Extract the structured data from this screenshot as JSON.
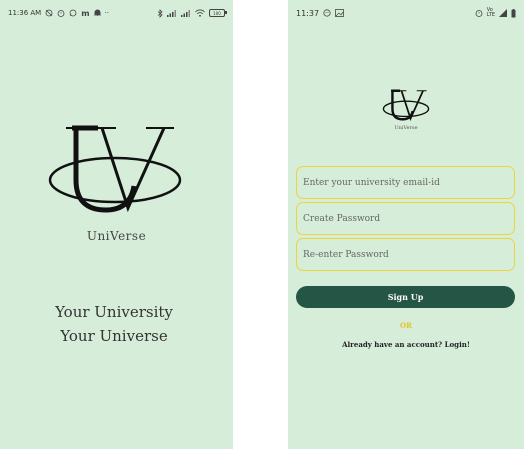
{
  "left_screen": {
    "status_bar": {
      "time": "11:36 AM",
      "misc": "··",
      "battery": "100",
      "left_icons": [
        "sync-off-icon",
        "alarm-icon",
        "whatsapp-icon",
        "m-app-icon",
        "ghost-icon"
      ],
      "right_icons": [
        "bluetooth-icon",
        "signal-icon",
        "signal-icon-2",
        "wifi-icon",
        "battery-icon"
      ]
    },
    "logo_name": "UniVerse",
    "tagline_1": "Your University",
    "tagline_2": "Your Universe"
  },
  "right_screen": {
    "status_bar": {
      "time": "11:37",
      "net_top": "Vo",
      "net_bottom": "LTE",
      "left_icons": [
        "face-icon",
        "gallery-icon"
      ],
      "right_icons": [
        "alarm-icon",
        "signal-icon",
        "battery-icon"
      ]
    },
    "logo_name": "UniVerse",
    "email_placeholder": "Enter your university email-id",
    "password_placeholder": "Create Password",
    "repassword_placeholder": "Re-enter Password",
    "signup_label": "Sign Up",
    "or_label": "OR",
    "login_text": "Already have an account? Login!"
  },
  "colors": {
    "background": "#d6eed9",
    "button": "#245545",
    "field_border": "#ecd43a",
    "or_text": "#e0c420"
  }
}
